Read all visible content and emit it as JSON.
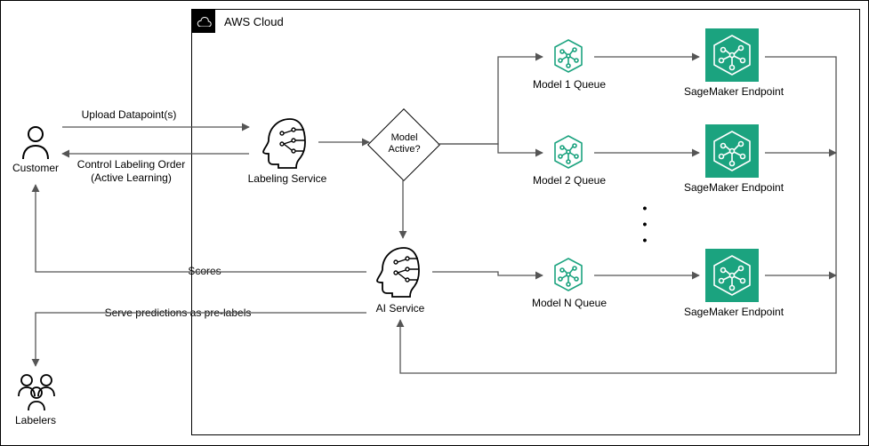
{
  "container_label": "AWS Cloud",
  "actors": {
    "customer": "Customer",
    "labelers": "Labelers"
  },
  "nodes": {
    "labeling_service": "Labeling Service",
    "model_active": "Model\nActive?",
    "ai_service": "AI Service",
    "model1_queue": "Model 1 Queue",
    "model2_queue": "Model 2 Queue",
    "modeln_queue": "Model N Queue",
    "sm_endpoint": "SageMaker Endpoint"
  },
  "edges": {
    "upload": "Upload Datapoint(s)",
    "control": "Control Labeling Order\n(Active Learning)",
    "scores": "Scores",
    "serve": "Serve predictions as pre-labels"
  },
  "ellipsis": "•\n•\n•"
}
